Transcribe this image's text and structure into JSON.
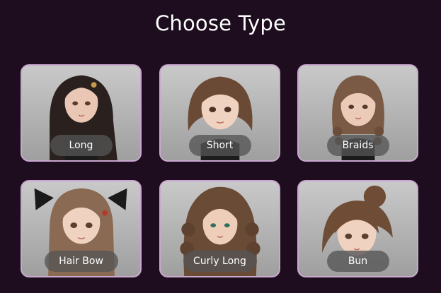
{
  "page": {
    "title": "Choose Type"
  },
  "colors": {
    "background": "#1d0d1e",
    "card_border": "#caa7cf",
    "pill_background": "#545454",
    "text": "#ffffff"
  },
  "types": [
    {
      "label": "Long",
      "hair_color": "#2a211e"
    },
    {
      "label": "Short",
      "hair_color": "#6b4a35"
    },
    {
      "label": "Braids",
      "hair_color": "#7a5a44"
    },
    {
      "label": "Hair Bow",
      "hair_color": "#8a6a52",
      "accessory": "bow-icon"
    },
    {
      "label": "Curly Long",
      "hair_color": "#6a4b36"
    },
    {
      "label": "Bun",
      "hair_color": "#6e4c36"
    }
  ]
}
